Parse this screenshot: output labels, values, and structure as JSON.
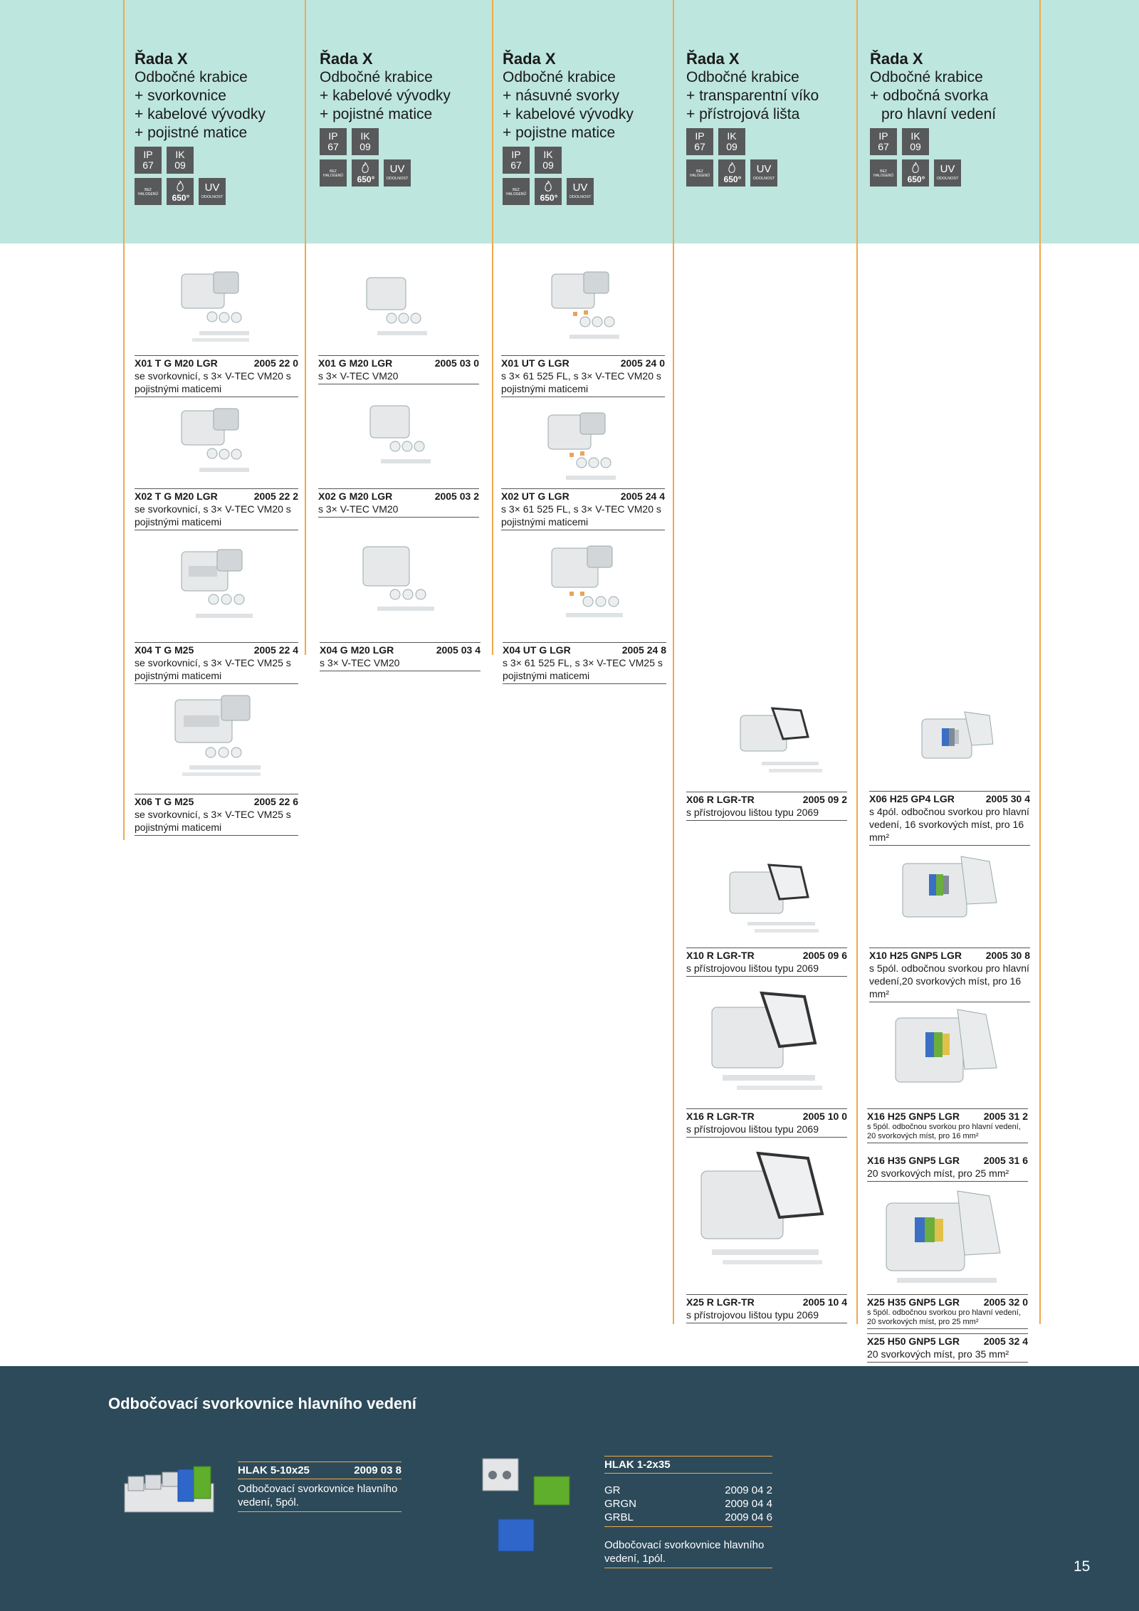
{
  "columns": [
    {
      "series": "Řada X",
      "lines": [
        "Odbočné krabice",
        "+ svorkovnice",
        "+ kabelové vývodky",
        "+ pojistné matice"
      ]
    },
    {
      "series": "Řada X",
      "lines": [
        "Odbočné krabice",
        "+ kabelové vývodky",
        "+ pojistné matice"
      ]
    },
    {
      "series": "Řada X",
      "lines": [
        "Odbočné krabice",
        "+ násuvné svorky",
        "+ kabelové vývodky",
        "+ pojistne matice"
      ]
    },
    {
      "series": "Řada X",
      "lines": [
        "Odbočné krabice",
        "+ transparentní víko",
        "+ přístrojová lišta"
      ]
    },
    {
      "series": "Řada X",
      "lines": [
        "Odbočné krabice",
        "+ odbočná svorka",
        "pro hlavní vedení"
      ]
    }
  ],
  "badges": {
    "ip": "IP",
    "ip_val": "67",
    "ik": "IK",
    "ik_val": "09",
    "bez": "BEZ HALOGENŮ",
    "temp": "650",
    "temp_unit": "°",
    "uv": "UV",
    "uv_sub": "ODOLNOST"
  },
  "items": [
    {
      "code": "X01 T G M20 LGR",
      "num": "2005 22 0",
      "desc": "se svorkovnicí, s 3× V-TEC VM20 s pojistnými maticemi"
    },
    {
      "code": "X02 T G M20 LGR",
      "num": "2005 22 2",
      "desc": "se svorkovnicí, s 3× V-TEC VM20 s pojistnými maticemi"
    },
    {
      "code": "X04 T G M25",
      "num": "2005 22 4",
      "desc": "se svorkovnicí, s 3× V-TEC VM25 s pojistnými maticemi"
    },
    {
      "code": "X06 T G M25",
      "num": "2005 22 6",
      "desc": "se svorkovnicí, s 3× V-TEC VM25 s pojistnými maticemi"
    },
    {
      "code": "X01 G M20 LGR",
      "num": "2005 03 0",
      "desc": "s 3× V-TEC VM20"
    },
    {
      "code": "X02 G M20 LGR",
      "num": "2005 03 2",
      "desc": "s 3× V-TEC VM20"
    },
    {
      "code": "X04 G M20 LGR",
      "num": "2005 03 4",
      "desc": "s 3× V-TEC VM20"
    },
    {
      "code": "X01 UT G LGR",
      "num": "2005 24 0",
      "desc": "s 3× 61 525 FL, s 3× V-TEC VM20 s pojistnými maticemi"
    },
    {
      "code": "X02 UT G LGR",
      "num": "2005 24 4",
      "desc": "s 3× 61 525 FL, s 3× V-TEC VM20 s pojistnými maticemi"
    },
    {
      "code": "X04 UT G LGR",
      "num": "2005 24 8",
      "desc": "s 3× 61 525 FL, s 3× V-TEC VM25 s pojistnými maticemi"
    },
    {
      "code": "X06 R LGR-TR",
      "num": "2005 09 2",
      "desc": "s přístrojovou lištou typu 2069"
    },
    {
      "code": "X10 R LGR-TR",
      "num": "2005 09 6",
      "desc": "s přístrojovou lištou typu 2069"
    },
    {
      "code": "X16 R LGR-TR",
      "num": "2005 10 0",
      "desc": "s přístrojovou lištou typu 2069"
    },
    {
      "code": "X25 R LGR-TR",
      "num": "2005 10 4",
      "desc": "s přístrojovou lištou typu 2069"
    },
    {
      "code": "X06 H25 GP4 LGR",
      "num": "2005 30 4",
      "desc": "s 4pól. odbočnou svorkou pro hlavní vedení, 16 svorkových míst, pro 16 mm²"
    },
    {
      "code": "X10 H25 GNP5 LGR",
      "num": "2005 30 8",
      "desc": "s 5pól. odbočnou svorkou pro hlavní vedení,20 svorkových míst, pro 16 mm²"
    },
    {
      "code": "X16 H25 GNP5 LGR",
      "num": "2005 31 2",
      "desc": "s 5pól. odbočnou svorkou pro hlavní vedení, 20 svorkových míst, pro 16 mm²"
    },
    {
      "code": "X16 H35 GNP5 LGR",
      "num": "2005 31 6",
      "desc": "20 svorkových míst, pro 25 mm²"
    },
    {
      "code": "X25 H35 GNP5 LGR",
      "num": "2005 32 0",
      "desc": "s 5pól. odbočnou svorkou pro hlavní vedení, 20 svorkových míst, pro 25 mm²"
    },
    {
      "code": "X25 H50 GNP5 LGR",
      "num": "2005 32 4",
      "desc": "20 svorkových míst, pro 35 mm²"
    }
  ],
  "footer": {
    "title": "Odbočovací svorkovnice hlavního vedení",
    "hlak5": {
      "code": "HLAK 5-10x25",
      "num": "2009 03 8",
      "desc": "Odbočovací svorkovnice hlavního vedení, 5pól."
    },
    "hlak1": {
      "code": "HLAK 1-2x35",
      "variants": [
        {
          "name": "GR",
          "num": "2009 04 2"
        },
        {
          "name": "GRGN",
          "num": "2009 04 4"
        },
        {
          "name": "GRBL",
          "num": "2009 04 6"
        }
      ],
      "desc": "Odbočovací svorkovnice hlavního vedení, 1pól."
    }
  },
  "page_number": "15",
  "colors": {
    "header": "#bde6de",
    "accent": "#f0a94a",
    "footer": "#2d4a5a",
    "badge": "#58595b"
  }
}
